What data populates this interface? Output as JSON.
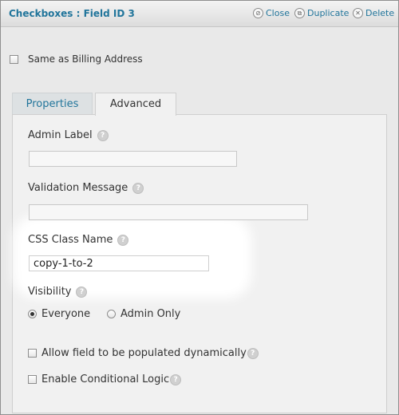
{
  "header": {
    "title": "Checkboxes : Field ID 3",
    "close_label": "Close",
    "duplicate_label": "Duplicate",
    "delete_label": "Delete"
  },
  "same_billing": {
    "label": "Same as Billing Address",
    "checked": false
  },
  "tabs": [
    {
      "label": "Properties",
      "active": false
    },
    {
      "label": "Advanced",
      "active": true
    }
  ],
  "fields": {
    "admin_label": {
      "label": "Admin Label",
      "help": "?",
      "value": ""
    },
    "validation_message": {
      "label": "Validation Message",
      "help": "?",
      "value": ""
    },
    "css_class": {
      "label": "CSS Class Name",
      "help": "?",
      "value": "copy-1-to-2"
    },
    "visibility": {
      "label": "Visibility",
      "help": "?",
      "options": [
        {
          "label": "Everyone",
          "selected": true
        },
        {
          "label": "Admin Only",
          "selected": false
        }
      ]
    },
    "allow_populate": {
      "label": "Allow field to be populated dynamically",
      "help": "?",
      "checked": false
    },
    "conditional_logic": {
      "label": "Enable Conditional Logic",
      "help": "?",
      "checked": false
    }
  }
}
